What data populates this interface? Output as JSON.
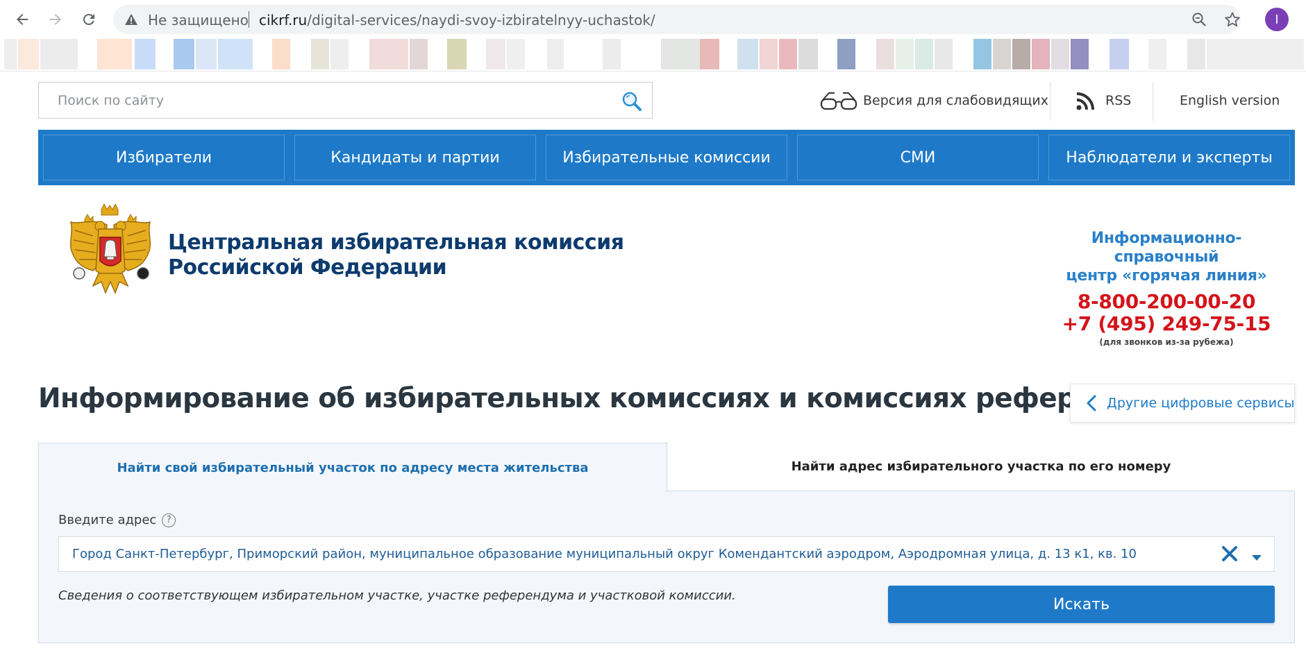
{
  "browser": {
    "security_label": "Не защищено",
    "url_host": "cikrf.ru",
    "url_path": "/digital-services/naydi-svoy-izbiratelnyy-uchastok/",
    "profile_initial": "I",
    "icons": [
      "back-icon",
      "forward-icon",
      "reload-icon",
      "warning-icon",
      "zoom-icon",
      "star-icon"
    ]
  },
  "header": {
    "search_placeholder": "Поиск по сайту",
    "low_vision_label": "Версия для слабовидящих",
    "rss_label": "RSS",
    "english_label": "English version"
  },
  "nav": {
    "items": [
      "Избиратели",
      "Кандидаты и партии",
      "Избирательные комиссии",
      "СМИ",
      "Наблюдатели и эксперты"
    ]
  },
  "org": {
    "line1": "Центральная избирательная комиссия",
    "line2": "Российской Федерации"
  },
  "hotline": {
    "title1": "Информационно-справочный",
    "title2": "центр «горячая линия»",
    "phone1": "8-800-200-00-20",
    "phone2": "+7 (495) 249-75-15",
    "note": "(для звонков из-за рубежа)"
  },
  "page": {
    "title": "Информирование об избирательных комиссиях и комиссиях референдума",
    "other_services": "Другие цифровые сервисы"
  },
  "tabs": [
    {
      "label": "Найти свой избирательный участок по адресу места жительства",
      "active": true
    },
    {
      "label": "Найти адрес избирательного участка по его номеру",
      "active": false
    }
  ],
  "form": {
    "address_label": "Введите адрес",
    "address_value": "Город Санкт-Петербург, Приморский район, муниципальное образование муниципальный округ Комендантский аэродром, Аэродромная улица, д. 13 к1, кв. 10",
    "hint": "Сведения о соответствующем избирательном участке, участке референдума и участковой комиссии.",
    "submit_label": "Искать"
  },
  "colors": {
    "accent": "#1e7ac8",
    "org_navy": "#0d3b6e",
    "hotline_red": "#d4141b",
    "hotline_blue": "#2a80c8"
  }
}
